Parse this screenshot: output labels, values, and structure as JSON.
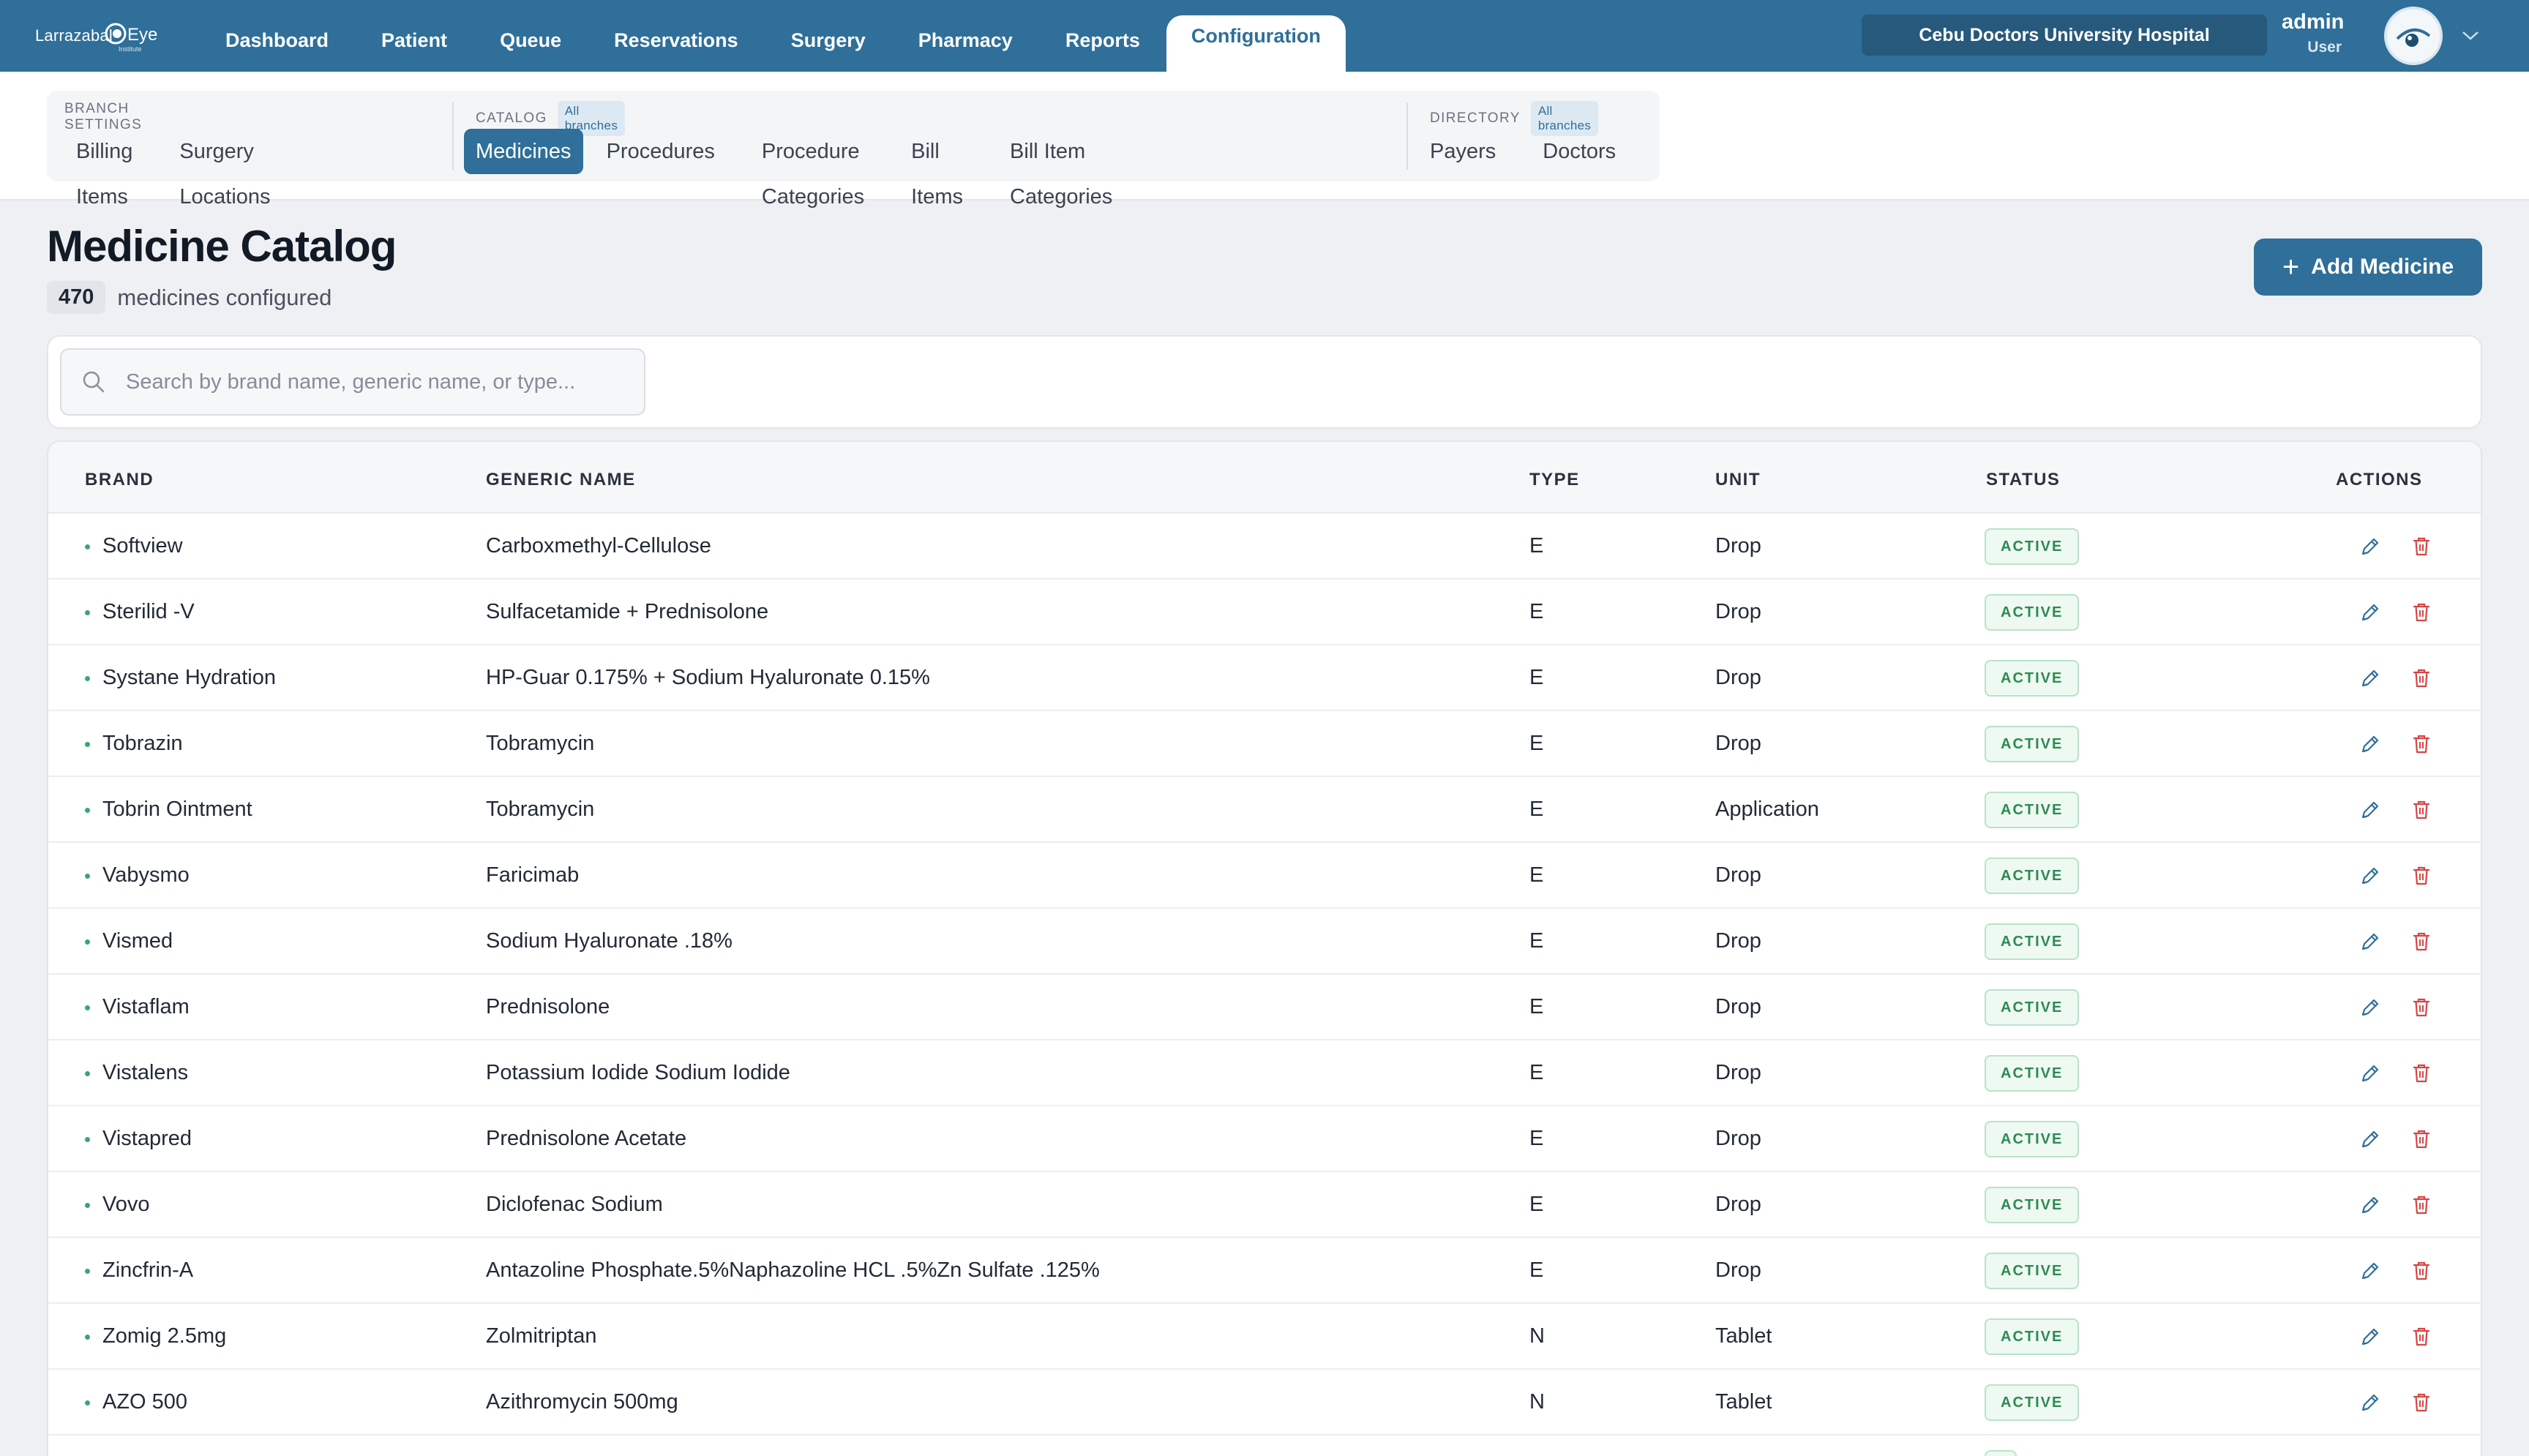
{
  "app": {
    "logo_text_left": "Larrazabal",
    "logo_text_right": "Eye",
    "logo_small": "Institute",
    "nav": [
      {
        "label": "Dashboard"
      },
      {
        "label": "Patient"
      },
      {
        "label": "Queue"
      },
      {
        "label": "Reservations"
      },
      {
        "label": "Surgery"
      },
      {
        "label": "Pharmacy"
      },
      {
        "label": "Reports"
      },
      {
        "label": "Configuration"
      }
    ],
    "active_nav": "Configuration",
    "hospital": "Cebu Doctors University Hospital",
    "user": {
      "name": "admin",
      "role": "User"
    }
  },
  "subnav": {
    "branch_settings": {
      "label": "BRANCH SETTINGS",
      "tabs": [
        "Billing Items",
        "Surgery Locations"
      ]
    },
    "catalog": {
      "label": "CATALOG",
      "badge": "All branches",
      "tabs": [
        "Medicines",
        "Procedures",
        "Procedure Categories",
        "Bill Items",
        "Bill Item Categories"
      ]
    },
    "directory": {
      "label": "DIRECTORY",
      "badge": "All branches",
      "tabs": [
        "Payers",
        "Doctors"
      ]
    },
    "active_tab": "Medicines"
  },
  "page": {
    "title": "Medicine Catalog",
    "count": "470",
    "count_label": "medicines configured",
    "add_button": "Add Medicine",
    "search_placeholder": "Search by brand name, generic name, or type..."
  },
  "table": {
    "columns": [
      "BRAND",
      "GENERIC NAME",
      "TYPE",
      "UNIT",
      "STATUS",
      "ACTIONS"
    ],
    "rows": [
      {
        "brand": "Softview",
        "generic": "Carboxmethyl-Cellulose",
        "type": "E",
        "unit": "Drop",
        "status": "ACTIVE"
      },
      {
        "brand": "Sterilid -V",
        "generic": "Sulfacetamide + Prednisolone",
        "type": "E",
        "unit": "Drop",
        "status": "ACTIVE"
      },
      {
        "brand": "Systane Hydration",
        "generic": "HP-Guar 0.175% + Sodium Hyaluronate 0.15%",
        "type": "E",
        "unit": "Drop",
        "status": "ACTIVE"
      },
      {
        "brand": "Tobrazin",
        "generic": "Tobramycin",
        "type": "E",
        "unit": "Drop",
        "status": "ACTIVE"
      },
      {
        "brand": "Tobrin Ointment",
        "generic": "Tobramycin",
        "type": "E",
        "unit": "Application",
        "status": "ACTIVE"
      },
      {
        "brand": "Vabysmo",
        "generic": "Faricimab",
        "type": "E",
        "unit": "Drop",
        "status": "ACTIVE"
      },
      {
        "brand": "Vismed",
        "generic": "Sodium Hyaluronate .18%",
        "type": "E",
        "unit": "Drop",
        "status": "ACTIVE"
      },
      {
        "brand": "Vistaflam",
        "generic": "Prednisolone",
        "type": "E",
        "unit": "Drop",
        "status": "ACTIVE"
      },
      {
        "brand": "Vistalens",
        "generic": "Potassium Iodide Sodium Iodide",
        "type": "E",
        "unit": "Drop",
        "status": "ACTIVE"
      },
      {
        "brand": "Vistapred",
        "generic": "Prednisolone Acetate",
        "type": "E",
        "unit": "Drop",
        "status": "ACTIVE"
      },
      {
        "brand": "Vovo",
        "generic": "Diclofenac Sodium",
        "type": "E",
        "unit": "Drop",
        "status": "ACTIVE"
      },
      {
        "brand": "Zincfrin-A",
        "generic": "Antazoline Phosphate.5%Naphazoline HCL .5%Zn Sulfate .125%",
        "type": "E",
        "unit": "Drop",
        "status": "ACTIVE"
      },
      {
        "brand": "Zomig 2.5mg",
        "generic": "Zolmitriptan",
        "type": "N",
        "unit": "Tablet",
        "status": "ACTIVE"
      },
      {
        "brand": "AZO 500",
        "generic": "Azithromycin 500mg",
        "type": "N",
        "unit": "Tablet",
        "status": "ACTIVE"
      },
      {
        "brand": "",
        "generic": "",
        "type": "",
        "unit": "",
        "status": ""
      }
    ]
  },
  "colors": {
    "primary": "#2f6f99",
    "active_status": "#2d8a52",
    "delete": "#d64545"
  },
  "icons": {
    "search": "search-icon",
    "edit": "pencil-icon",
    "delete": "trash-icon",
    "add": "plus-icon",
    "chevron": "chevron-down-icon"
  }
}
